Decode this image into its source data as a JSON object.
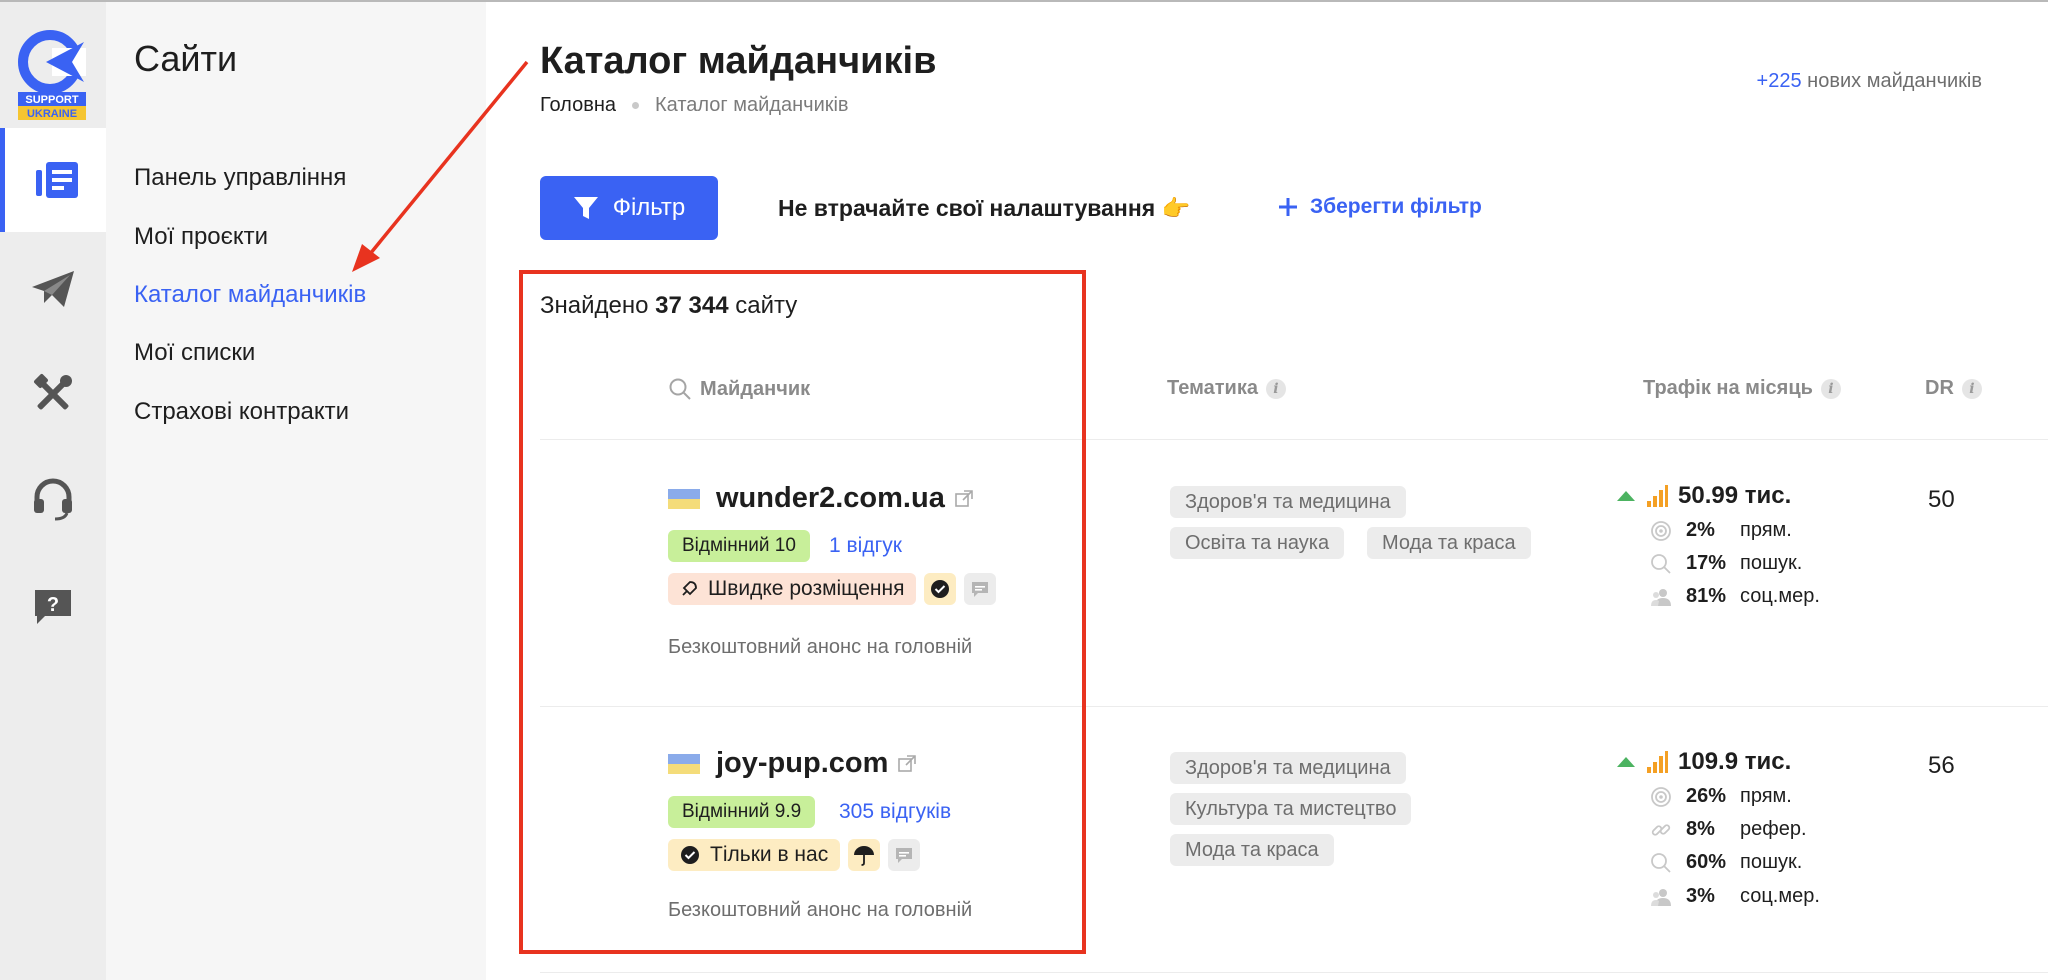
{
  "brand": {
    "logo_text_top": "SUPPORT",
    "logo_text_bottom": "UKRAINE",
    "accent": "#3a62f3"
  },
  "rail": [
    {
      "icon": "catalog-list-icon",
      "active": true
    },
    {
      "icon": "paper-plane-icon",
      "active": false
    },
    {
      "icon": "tools-icon",
      "active": false
    },
    {
      "icon": "headset-icon",
      "active": false
    },
    {
      "icon": "help-chat-icon",
      "active": false
    }
  ],
  "nav": {
    "title": "Сайти",
    "items": [
      {
        "label": "Панель управління"
      },
      {
        "label": "Мої проєкти"
      },
      {
        "label": "Каталог майданчиків",
        "active": true
      },
      {
        "label": "Мої списки"
      },
      {
        "label": "Страхові контракти"
      }
    ]
  },
  "header": {
    "title": "Каталог майданчиків",
    "breadcrumb": {
      "home": "Головна",
      "current": "Каталог майданчиків"
    },
    "new_sites_count": "+225",
    "new_sites_label": "нових майданчиків"
  },
  "toolbar": {
    "filter_label": "Фільтр",
    "hint": "Не втрачайте свої налаштування 👉",
    "save_filter_label": "Зберегти фільтр"
  },
  "results": {
    "found_prefix": "Знайдено",
    "found_count": "37 344",
    "found_suffix": "сайту"
  },
  "columns": {
    "site_placeholder": "Майданчик",
    "topic": "Тематика",
    "traffic": "Трафік на місяць",
    "dr": "DR"
  },
  "sites": [
    {
      "name": "wunder2.com.ua",
      "rating": "Відмінний 10",
      "reviews": "1 відгук",
      "badge": "Швидке розміщення",
      "anons": "Безкоштовний анонс на головній",
      "tags": [
        "Здоров'я та медицина",
        "Освіта та наука",
        "Мода та краса"
      ],
      "traffic": "50.99 тис.",
      "breakdown": [
        {
          "pct": "2%",
          "label": "прям."
        },
        {
          "pct": "17%",
          "label": "пошук."
        },
        {
          "pct": "81%",
          "label": "соц.мер."
        }
      ],
      "dr": "50"
    },
    {
      "name": "joy-pup.com",
      "rating": "Відмінний 9.9",
      "reviews": "305 відгуків",
      "badge": "Тільки в нас",
      "anons": "Безкоштовний анонс на головній",
      "tags": [
        "Здоров'я та медицина",
        "Культура та мистецтво",
        "Мода та краса"
      ],
      "traffic": "109.9 тис.",
      "breakdown": [
        {
          "pct": "26%",
          "label": "прям."
        },
        {
          "pct": "8%",
          "label": "рефер."
        },
        {
          "pct": "60%",
          "label": "пошук."
        },
        {
          "pct": "3%",
          "label": "соц.мер."
        }
      ],
      "dr": "56"
    }
  ],
  "annotation_color": "#e8331f"
}
